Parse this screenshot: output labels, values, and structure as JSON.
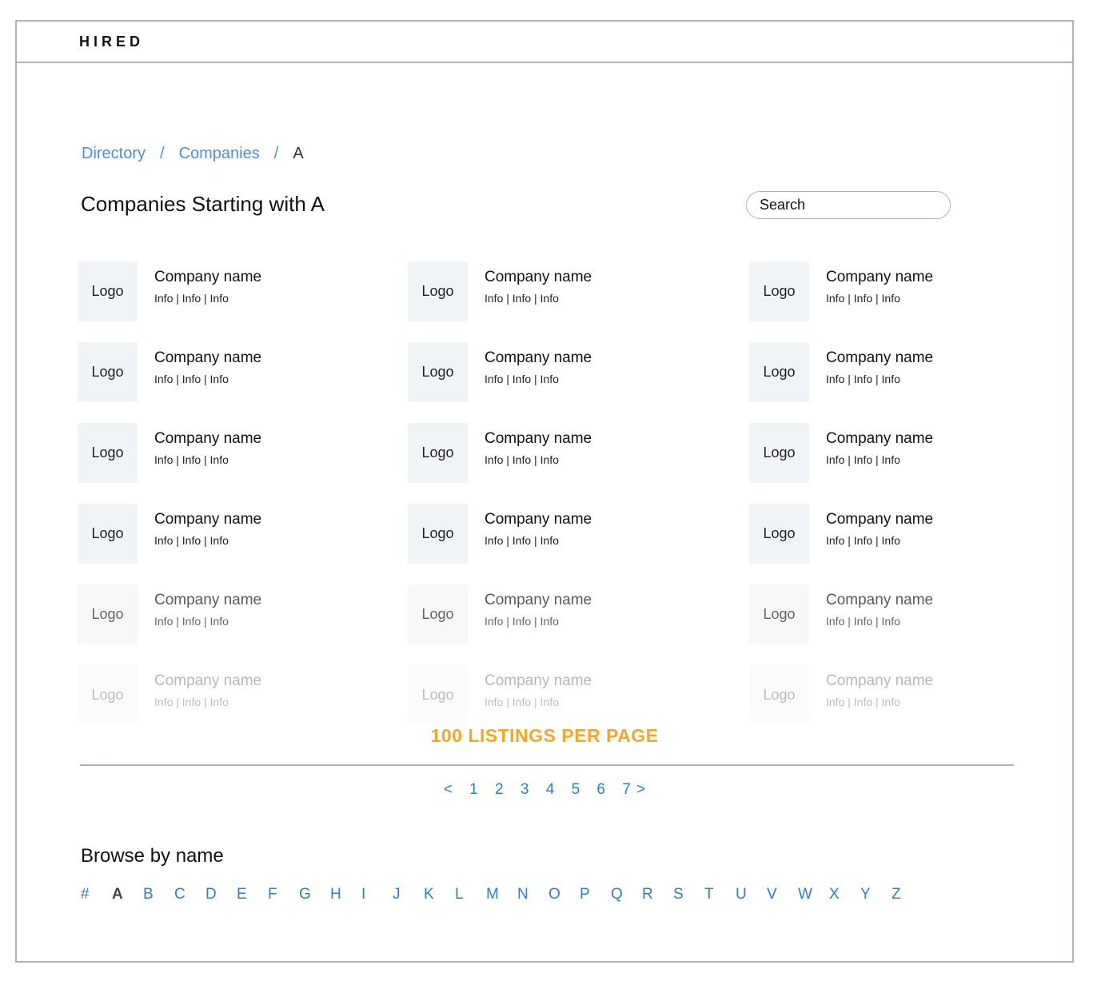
{
  "header": {
    "brand": "HIRED"
  },
  "breadcrumb": {
    "items": [
      "Directory",
      "Companies"
    ],
    "separator": "/",
    "current": "A"
  },
  "page_title": "Companies Starting with A",
  "search": {
    "placeholder": "Search"
  },
  "companies": {
    "logo_label": "Logo",
    "name": "Company name",
    "info": "Info | Info | Info",
    "rows": 6,
    "columns": 3,
    "row_opacity": [
      1,
      1,
      1,
      1,
      0.7,
      0.3
    ]
  },
  "listings_note": "100 LISTINGS PER PAGE",
  "pagination": {
    "prev": "<",
    "pages": [
      "1",
      "2",
      "3",
      "4",
      "5",
      "6",
      "7"
    ],
    "next": ">"
  },
  "browse": {
    "title": "Browse by name",
    "letters": [
      "#",
      "A",
      "B",
      "C",
      "D",
      "E",
      "F",
      "G",
      "H",
      "I",
      "J",
      "K",
      "L",
      "M",
      "N",
      "O",
      "P",
      "Q",
      "R",
      "S",
      "T",
      "U",
      "V",
      "W",
      "X",
      "Y",
      "Z"
    ],
    "active": "A"
  },
  "colors": {
    "link": "#2b7fc8",
    "breadcrumb_link": "#4a90d9",
    "accent": "#f5a623",
    "border": "#aab4bd",
    "logo_bg": "#f1f4f7"
  }
}
